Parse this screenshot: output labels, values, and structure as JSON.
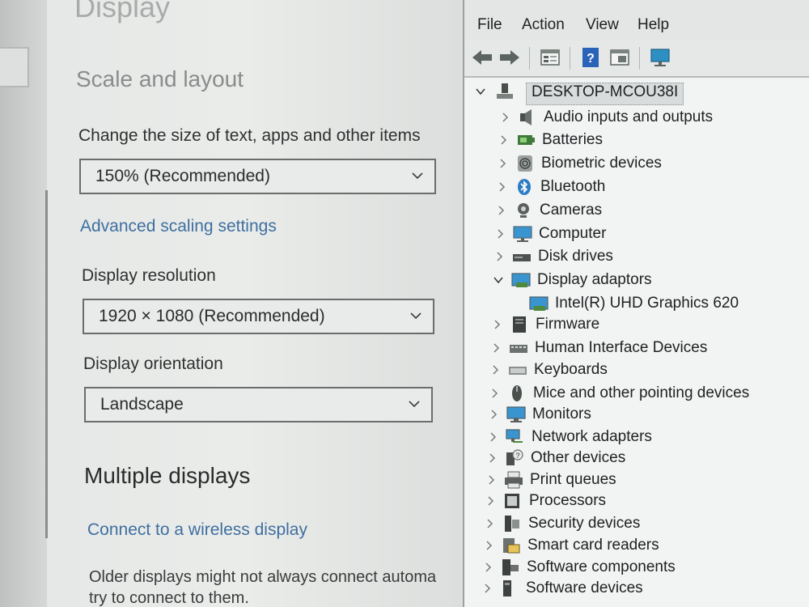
{
  "settings": {
    "page_title": "Display",
    "section_title": "Scale and layout",
    "scale_label": "Change the size of text, apps and other items",
    "scale_value": "150% (Recommended)",
    "advanced_link": "Advanced scaling settings",
    "resolution_label": "Display resolution",
    "resolution_value": "1920 × 1080 (Recommended)",
    "orientation_label": "Display orientation",
    "orientation_value": "Landscape",
    "multi_title": "Multiple displays",
    "wireless_link": "Connect to a wireless display",
    "older_line1": "Older displays might not always connect automa",
    "older_line2": "try to connect to them."
  },
  "devmgr": {
    "menu": [
      "File",
      "Action",
      "View",
      "Help"
    ],
    "toolbar_icons": [
      "back-arrow-icon",
      "forward-arrow-icon",
      "properties-icon",
      "help-icon",
      "update-driver-icon",
      "monitor-scan-icon"
    ],
    "root": "DESKTOP-MCOU38I",
    "items": [
      {
        "label": "Audio inputs and outputs",
        "icon": "speaker-icon",
        "state": "collapsed"
      },
      {
        "label": "Batteries",
        "icon": "battery-icon",
        "state": "collapsed"
      },
      {
        "label": "Biometric devices",
        "icon": "fingerprint-icon",
        "state": "collapsed"
      },
      {
        "label": "Bluetooth",
        "icon": "bluetooth-icon",
        "state": "collapsed"
      },
      {
        "label": "Cameras",
        "icon": "camera-icon",
        "state": "collapsed"
      },
      {
        "label": "Computer",
        "icon": "computer-icon",
        "state": "collapsed"
      },
      {
        "label": "Disk drives",
        "icon": "disk-icon",
        "state": "collapsed"
      },
      {
        "label": "Display adaptors",
        "icon": "display-adapter-icon",
        "state": "expanded"
      },
      {
        "label": "Intel(R) UHD Graphics 620",
        "icon": "display-adapter-icon",
        "state": "child"
      },
      {
        "label": "Firmware",
        "icon": "firmware-icon",
        "state": "collapsed"
      },
      {
        "label": "Human Interface Devices",
        "icon": "hid-icon",
        "state": "collapsed"
      },
      {
        "label": "Keyboards",
        "icon": "keyboard-icon",
        "state": "collapsed"
      },
      {
        "label": "Mice and other pointing devices",
        "icon": "mouse-icon",
        "state": "collapsed"
      },
      {
        "label": "Monitors",
        "icon": "monitor-icon",
        "state": "collapsed"
      },
      {
        "label": "Network adapters",
        "icon": "network-icon",
        "state": "collapsed"
      },
      {
        "label": "Other devices",
        "icon": "unknown-device-icon",
        "state": "collapsed"
      },
      {
        "label": "Print queues",
        "icon": "printer-icon",
        "state": "collapsed"
      },
      {
        "label": "Processors",
        "icon": "processor-icon",
        "state": "collapsed"
      },
      {
        "label": "Security devices",
        "icon": "security-device-icon",
        "state": "collapsed"
      },
      {
        "label": "Smart card readers",
        "icon": "smart-card-icon",
        "state": "collapsed"
      },
      {
        "label": "Software components",
        "icon": "software-component-icon",
        "state": "collapsed"
      },
      {
        "label": "Software devices",
        "icon": "software-device-icon",
        "state": "collapsed"
      }
    ]
  },
  "colors": {
    "link": "#3f6f9f",
    "accent_blue": "#2b7bc4"
  }
}
